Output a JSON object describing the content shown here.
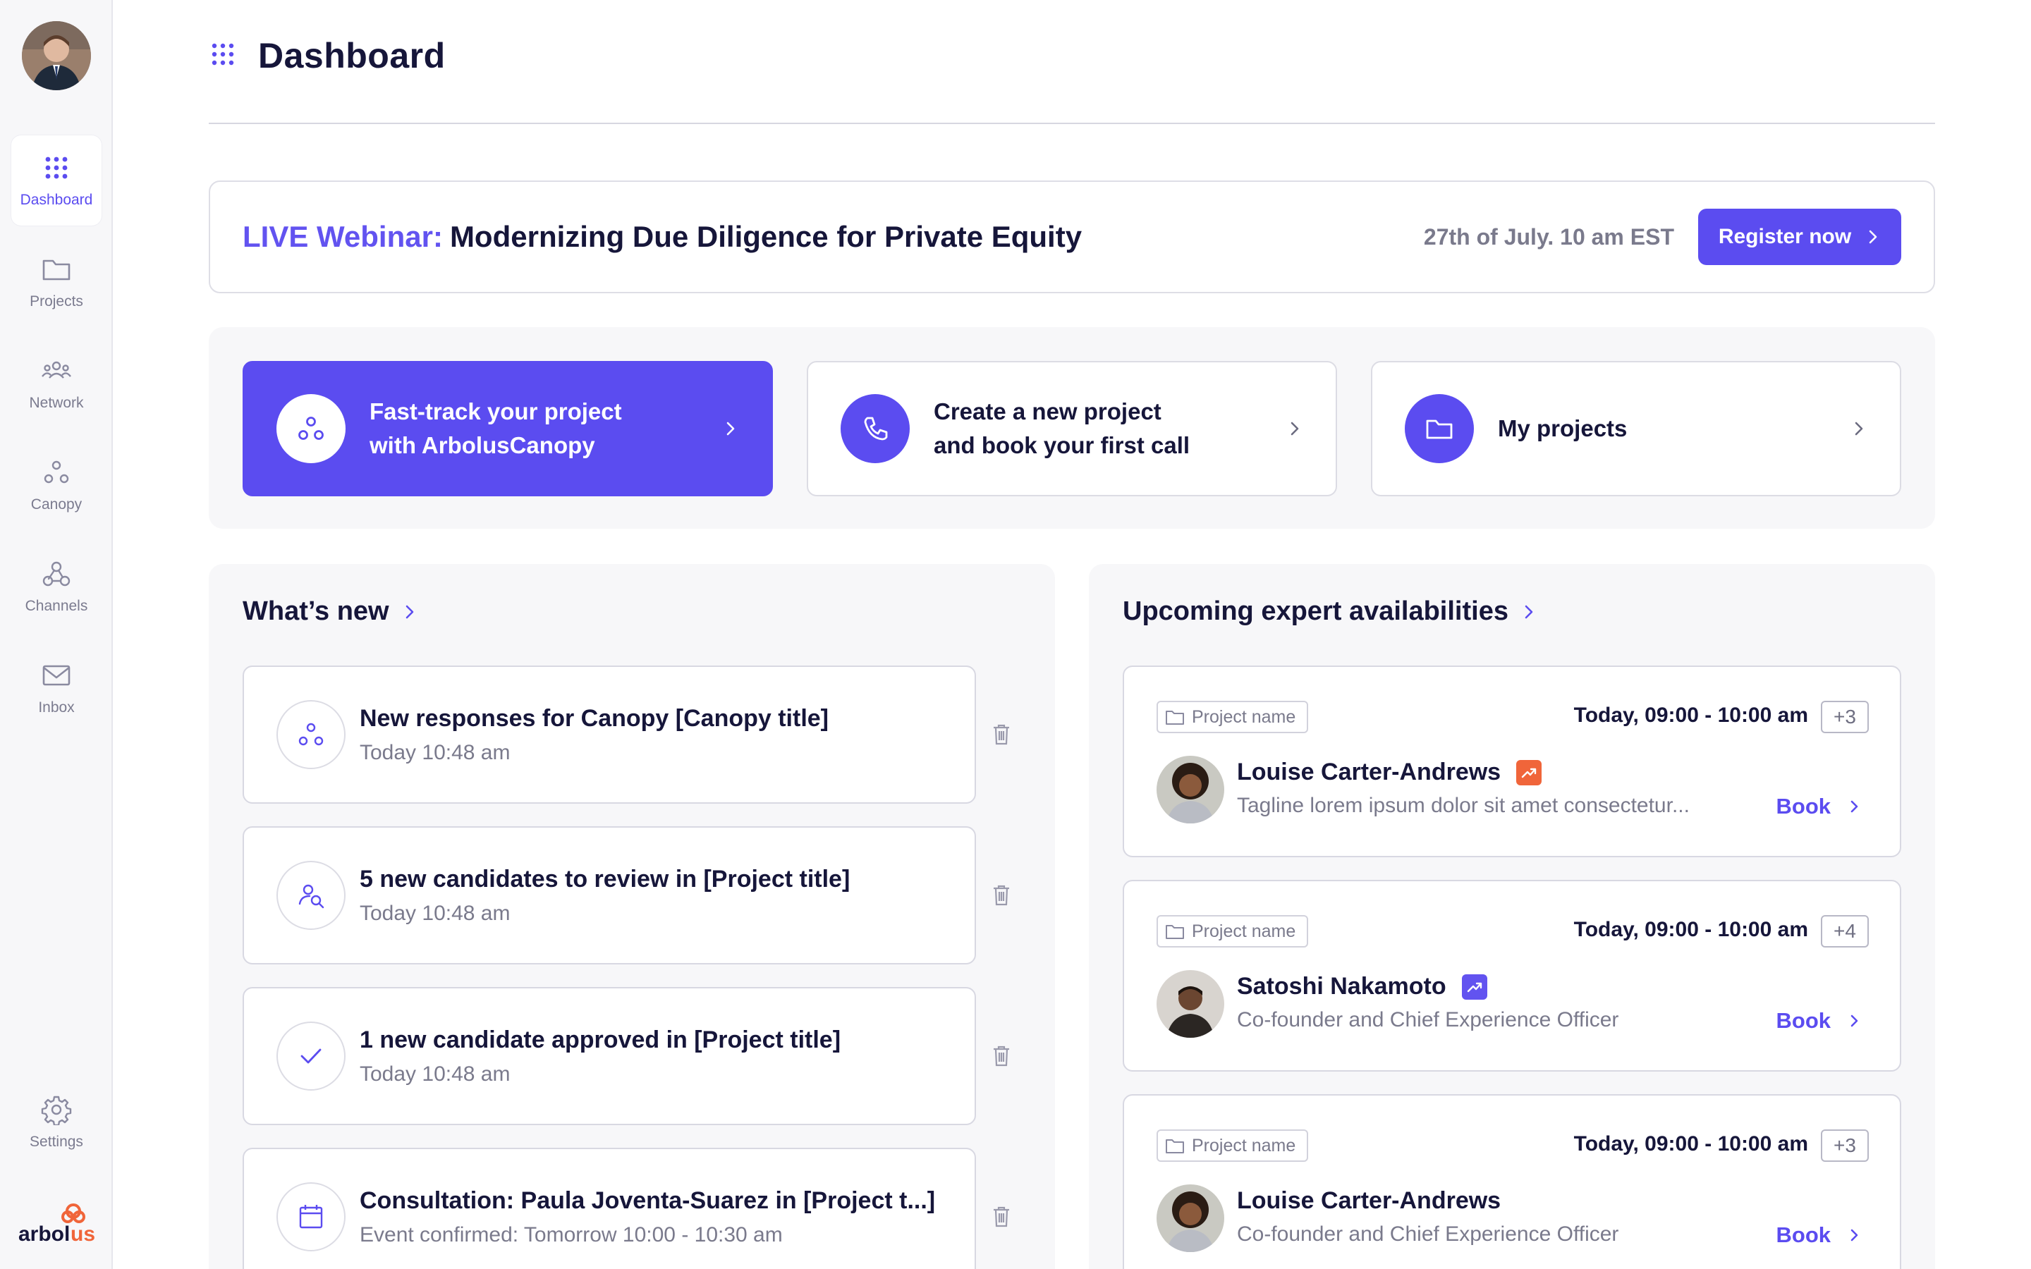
{
  "sidebar": {
    "items": [
      {
        "label": "Dashboard",
        "icon": "grid-icon"
      },
      {
        "label": "Projects",
        "icon": "folder-icon"
      },
      {
        "label": "Network",
        "icon": "people-icon"
      },
      {
        "label": "Canopy",
        "icon": "canopy-icon"
      },
      {
        "label": "Channels",
        "icon": "webhook-icon"
      },
      {
        "label": "Inbox",
        "icon": "mail-icon"
      }
    ],
    "settings_label": "Settings",
    "logo_text": "arbolus"
  },
  "header": {
    "title": "Dashboard"
  },
  "banner": {
    "live_label": "LIVE Webinar:",
    "title": "Modernizing Due Diligence for Private Equity",
    "date": "27th of July. 10 am EST",
    "button_label": "Register now"
  },
  "quick_actions": [
    {
      "line1": "Fast-track your project",
      "line2": "with ArbolusCanopy",
      "icon": "canopy-icon"
    },
    {
      "line1": "Create a new project",
      "line2": "and book your first call",
      "icon": "phone-icon"
    },
    {
      "line1": "My projects",
      "line2": "",
      "icon": "folder-icon"
    }
  ],
  "whats_new": {
    "heading": "What’s new",
    "items": [
      {
        "title": "New responses for Canopy [Canopy title]",
        "subtitle": "Today 10:48 am",
        "icon": "canopy-icon"
      },
      {
        "title": "5 new candidates to review in [Project title]",
        "subtitle": "Today 10:48 am",
        "icon": "user-search-icon"
      },
      {
        "title": "1 new candidate approved in [Project title]",
        "subtitle": "Today 10:48 am",
        "icon": "check-icon"
      },
      {
        "title": "Consultation: Paula Joventa-Suarez in [Project t...]",
        "subtitle": "Event confirmed: Tomorrow 10:00 - 10:30 am",
        "icon": "calendar-icon"
      }
    ]
  },
  "upcoming": {
    "heading": "Upcoming expert availabilities",
    "cards": [
      {
        "project": "Project name",
        "time": "Today, 09:00 - 10:00 am",
        "more": "+3",
        "name": "Louise Carter-Andrews",
        "tagline": "Tagline lorem ipsum dolor sit amet  consectetur...",
        "book": "Book",
        "trend_color": "#f0653a"
      },
      {
        "project": "Project name",
        "time": "Today, 09:00 - 10:00 am",
        "more": "+4",
        "name": "Satoshi Nakamoto",
        "tagline": "Co-founder and Chief Experience Officer",
        "book": "Book",
        "trend_color": "#6253f0"
      },
      {
        "project": "Project name",
        "time": "Today, 09:00 - 10:00 am",
        "more": "+3",
        "name": "Louise Carter-Andrews",
        "tagline": "Co-founder and Chief Experience Officer",
        "book": "Book",
        "trend_color": ""
      }
    ]
  },
  "colors": {
    "accent": "#5b4cf0",
    "text": "#16163a",
    "muted": "#7a7a8c",
    "trend_orange": "#f0653a"
  }
}
